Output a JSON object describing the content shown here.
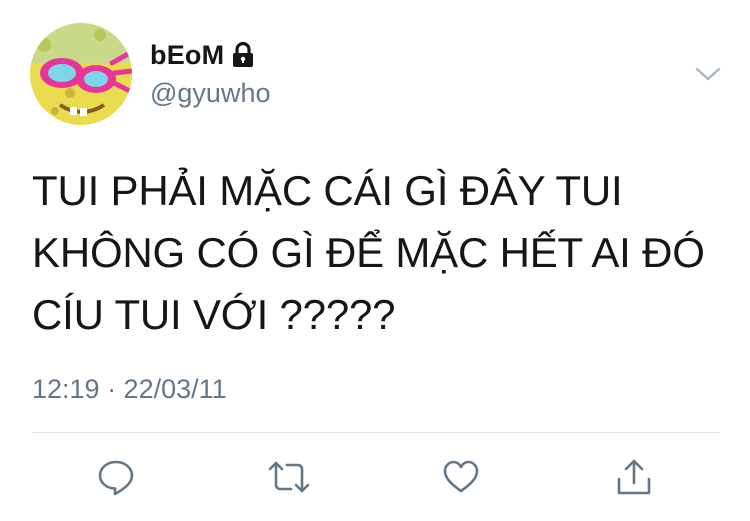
{
  "user": {
    "display_name": "bEoM",
    "handle": "@gyuwho",
    "lock_icon": "lock-icon",
    "avatar_icon": "avatar-image"
  },
  "tweet": {
    "lines": [
      "TUI PHẢI MẶC CÁI GÌ ĐÂY TUI",
      "KHÔNG CÓ GÌ ĐỂ MẶC HẾT AI ĐÓ",
      "CÍU TUI VỚI ?????"
    ],
    "timestamp": "12:19 · 22/03/11"
  },
  "actions": {
    "reply_icon": "reply-icon",
    "retweet_icon": "retweet-icon",
    "like_icon": "heart-icon",
    "share_icon": "share-icon",
    "more_icon": "chevron-down-icon"
  },
  "colors": {
    "text": "#14171a",
    "secondary": "#657786",
    "icon": "#657786",
    "divider": "#dfe4e8"
  }
}
